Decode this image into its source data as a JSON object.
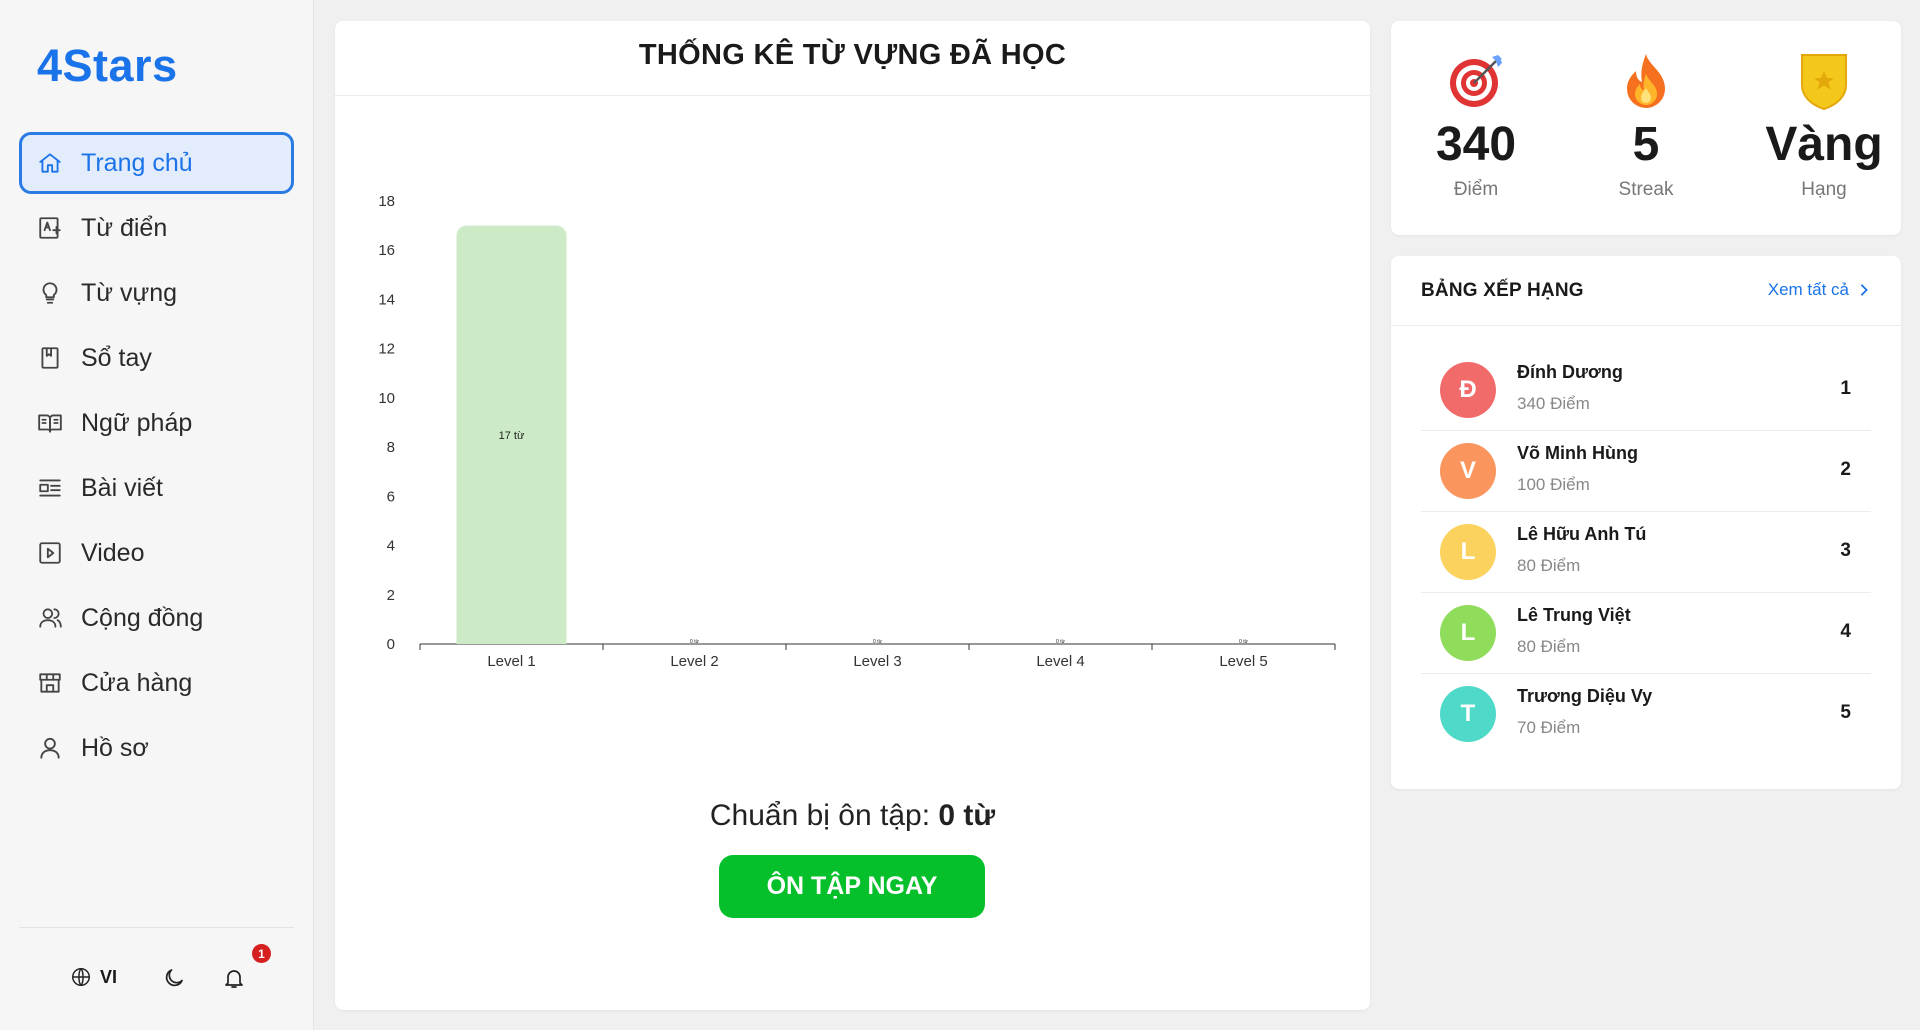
{
  "app": {
    "logo": "4Stars"
  },
  "sidebar": {
    "items": [
      {
        "label": "Trang chủ",
        "icon": "home-icon",
        "active": true
      },
      {
        "label": "Từ điển",
        "icon": "dictionary-icon",
        "active": false
      },
      {
        "label": "Từ vựng",
        "icon": "lightbulb-icon",
        "active": false
      },
      {
        "label": "Sổ tay",
        "icon": "notebook-icon",
        "active": false
      },
      {
        "label": "Ngữ pháp",
        "icon": "book-open-icon",
        "active": false
      },
      {
        "label": "Bài viết",
        "icon": "article-icon",
        "active": false
      },
      {
        "label": "Video",
        "icon": "play-icon",
        "active": false
      },
      {
        "label": "Cộng đồng",
        "icon": "community-icon",
        "active": false
      },
      {
        "label": "Cửa hàng",
        "icon": "store-icon",
        "active": false
      },
      {
        "label": "Hồ sơ",
        "icon": "user-icon",
        "active": false
      }
    ],
    "language": "VI",
    "notification_count": "1"
  },
  "main": {
    "title": "THỐNG KÊ TỪ VỰNG ĐÃ HỌC",
    "review_prefix": "Chuẩn bị ôn tập: ",
    "review_count": "0 từ",
    "review_button": "ÔN TẬP NGAY"
  },
  "chart_data": {
    "type": "bar",
    "categories": [
      "Level 1",
      "Level 2",
      "Level 3",
      "Level 4",
      "Level 5"
    ],
    "values": [
      17,
      0,
      0,
      0,
      0
    ],
    "data_labels": [
      "17 từ",
      "0 từ",
      "0 từ",
      "0 từ",
      "0 từ"
    ],
    "yticks": [
      0,
      2,
      4,
      6,
      8,
      10,
      12,
      14,
      16,
      18
    ],
    "ylim": [
      0,
      18
    ],
    "bar_color": "#cdeac6",
    "grid": false
  },
  "stats": [
    {
      "value": "340",
      "caption": "Điểm",
      "icon": "target-icon"
    },
    {
      "value": "5",
      "caption": "Streak",
      "icon": "fire-icon"
    },
    {
      "value": "Vàng",
      "caption": "Hạng",
      "icon": "gold-badge-icon"
    }
  ],
  "leaderboard": {
    "title": "BẢNG XẾP HẠNG",
    "view_all": "Xem tất cả",
    "rows": [
      {
        "initial": "Đ",
        "name": "Đính Dương",
        "points": "340 Điểm",
        "rank": "1",
        "color": "#f26b6b"
      },
      {
        "initial": "V",
        "name": "Võ Minh Hùng",
        "points": "100 Điểm",
        "rank": "2",
        "color": "#f9955d"
      },
      {
        "initial": "L",
        "name": "Lê Hữu Anh Tú",
        "points": "80 Điểm",
        "rank": "3",
        "color": "#fbd25e"
      },
      {
        "initial": "L",
        "name": "Lê Trung Việt",
        "points": "80 Điểm",
        "rank": "4",
        "color": "#8fdd5b"
      },
      {
        "initial": "T",
        "name": "Trương Diệu Vy",
        "points": "70 Điểm",
        "rank": "5",
        "color": "#4fd9c9"
      }
    ]
  }
}
